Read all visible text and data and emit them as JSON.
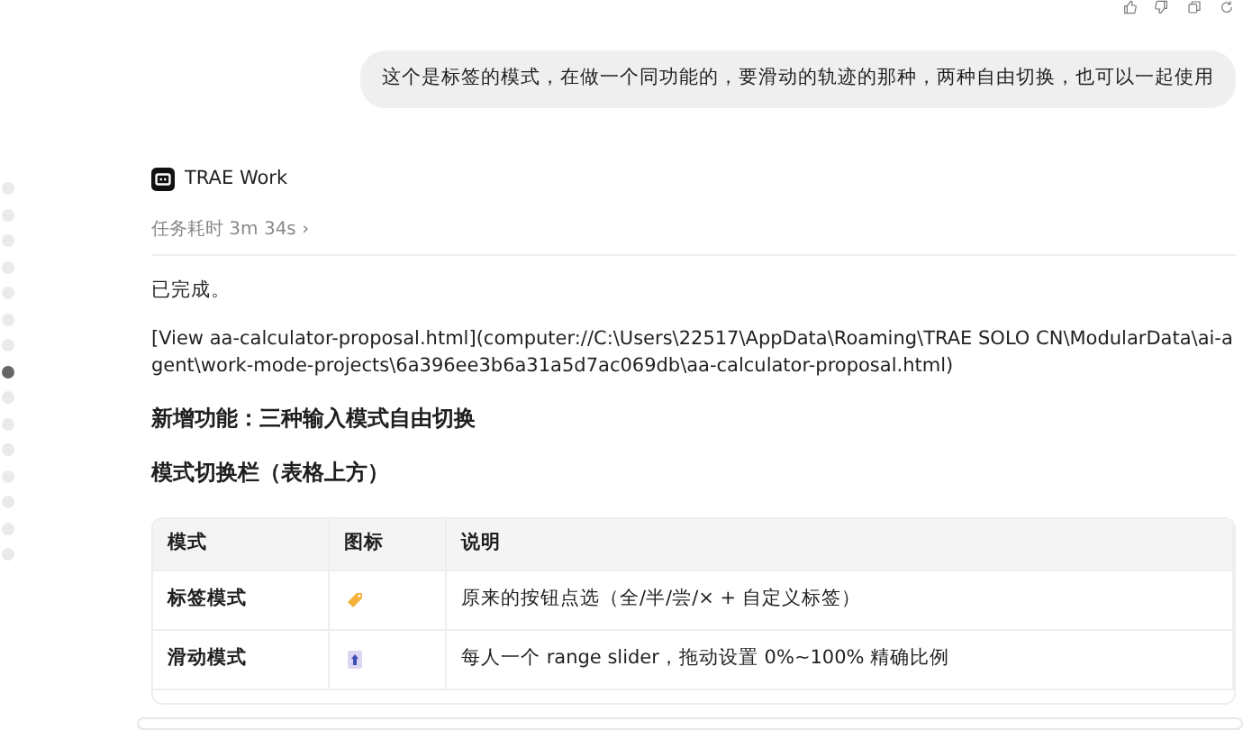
{
  "user_message": "这个是标签的模式，在做一个同功能的，要滑动的轨迹的那种，两种自由切换，也可以一起使用",
  "timeline_dots": [
    {
      "selected": false
    },
    {
      "selected": false
    },
    {
      "selected": false
    },
    {
      "selected": false
    },
    {
      "selected": false
    },
    {
      "selected": false
    },
    {
      "selected": false
    },
    {
      "selected": true
    },
    {
      "selected": false
    },
    {
      "selected": false
    },
    {
      "selected": false
    },
    {
      "selected": false
    },
    {
      "selected": false
    },
    {
      "selected": false
    },
    {
      "selected": false
    }
  ],
  "agent": {
    "name": "TRAE Work",
    "duration": "任务耗时 3m 34s",
    "expand_icon": "›"
  },
  "content": [
    {
      "kind": "paragraph",
      "text": "已完成。"
    },
    {
      "kind": "paragraph",
      "text": "[View aa-calculator-proposal.html](computer://C:\\Users\\22517\\AppData\\Roaming\\TRAE SOLO CN\\ModularData\\ai-agent\\work-mode-projects\\6a396ee3b6a31a5d7ac069db\\aa-calculator-proposal.html)"
    },
    {
      "kind": "heading",
      "text": "新增功能：三种输入模式自由切换"
    },
    {
      "kind": "heading",
      "text": "模式切换栏（表格上方）"
    }
  ],
  "table": {
    "columns": [
      "模式",
      "图标",
      "说明"
    ],
    "rows": [
      {
        "mode": "标签模式",
        "description": "原来的按钮点选（全/半/尝/× + 自定义标签）"
      },
      {
        "mode": "滑动模式",
        "description": "每人一个 range slider，拖动设置 0%~100% 精确比例"
      }
    ]
  }
}
